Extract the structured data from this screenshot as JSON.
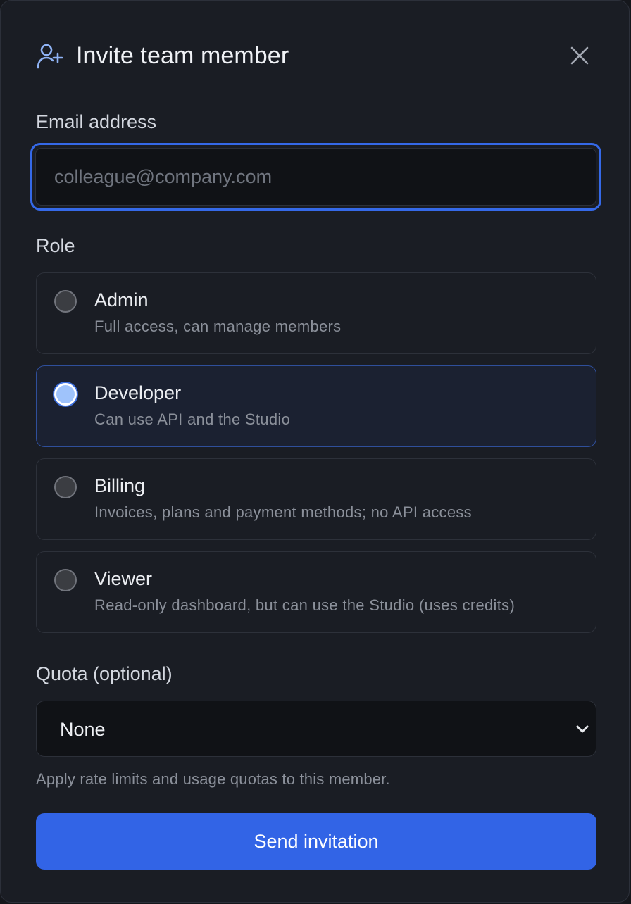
{
  "dialog": {
    "title": "Invite team member",
    "header_icon": "user-plus-icon",
    "close_icon": "close-icon"
  },
  "email": {
    "label": "Email address",
    "placeholder": "colleague@company.com",
    "value": ""
  },
  "role": {
    "label": "Role",
    "selected": "Developer",
    "options": [
      {
        "name": "Admin",
        "description": "Full access, can manage members",
        "checked": false
      },
      {
        "name": "Developer",
        "description": "Can use API and the Studio",
        "checked": true
      },
      {
        "name": "Billing",
        "description": "Invoices, plans and payment methods; no API access",
        "checked": false
      },
      {
        "name": "Viewer",
        "description": "Read-only dashboard, but can use the Studio (uses credits)",
        "checked": false
      }
    ]
  },
  "quota": {
    "label": "Quota (optional)",
    "selected": "None",
    "helper": "Apply rate limits and usage quotas to this member.",
    "icon": "chevron-down-icon"
  },
  "actions": {
    "submit_label": "Send invitation"
  },
  "colors": {
    "accent": "#3264e6",
    "focus_ring": "#3569e8",
    "background": "#1a1d24",
    "selected_card_bg": "#1b2131"
  }
}
